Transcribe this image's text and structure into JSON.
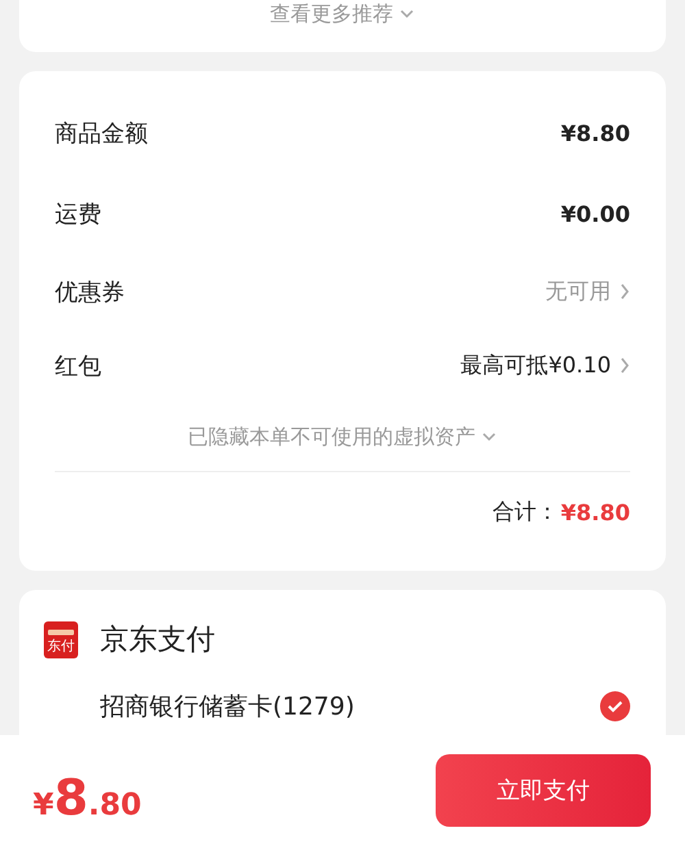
{
  "recommend": {
    "label": "查看更多推荐"
  },
  "summary": {
    "rows": [
      {
        "label": "商品金额",
        "value": "¥8.80",
        "muted": false,
        "arrow": false,
        "bold": true
      },
      {
        "label": "运费",
        "value": "¥0.00",
        "muted": false,
        "arrow": false,
        "bold": true
      },
      {
        "label": "优惠券",
        "value": "无可用",
        "muted": true,
        "arrow": true,
        "bold": false
      },
      {
        "label": "红包",
        "value": "最高可抵¥0.10",
        "muted": false,
        "arrow": true,
        "bold": false
      }
    ],
    "hidden_note": "已隐藏本单不可使用的虚拟资产",
    "total_label": "合计：",
    "total_value": "¥8.80"
  },
  "payment": {
    "method": "京东支付",
    "logo_text": "东付",
    "options": [
      {
        "label": "招商银行储蓄卡(1279)",
        "selected": true
      }
    ]
  },
  "footer": {
    "currency": "¥",
    "integer": "8",
    "decimal": ".80",
    "pay_button": "立即支付"
  }
}
